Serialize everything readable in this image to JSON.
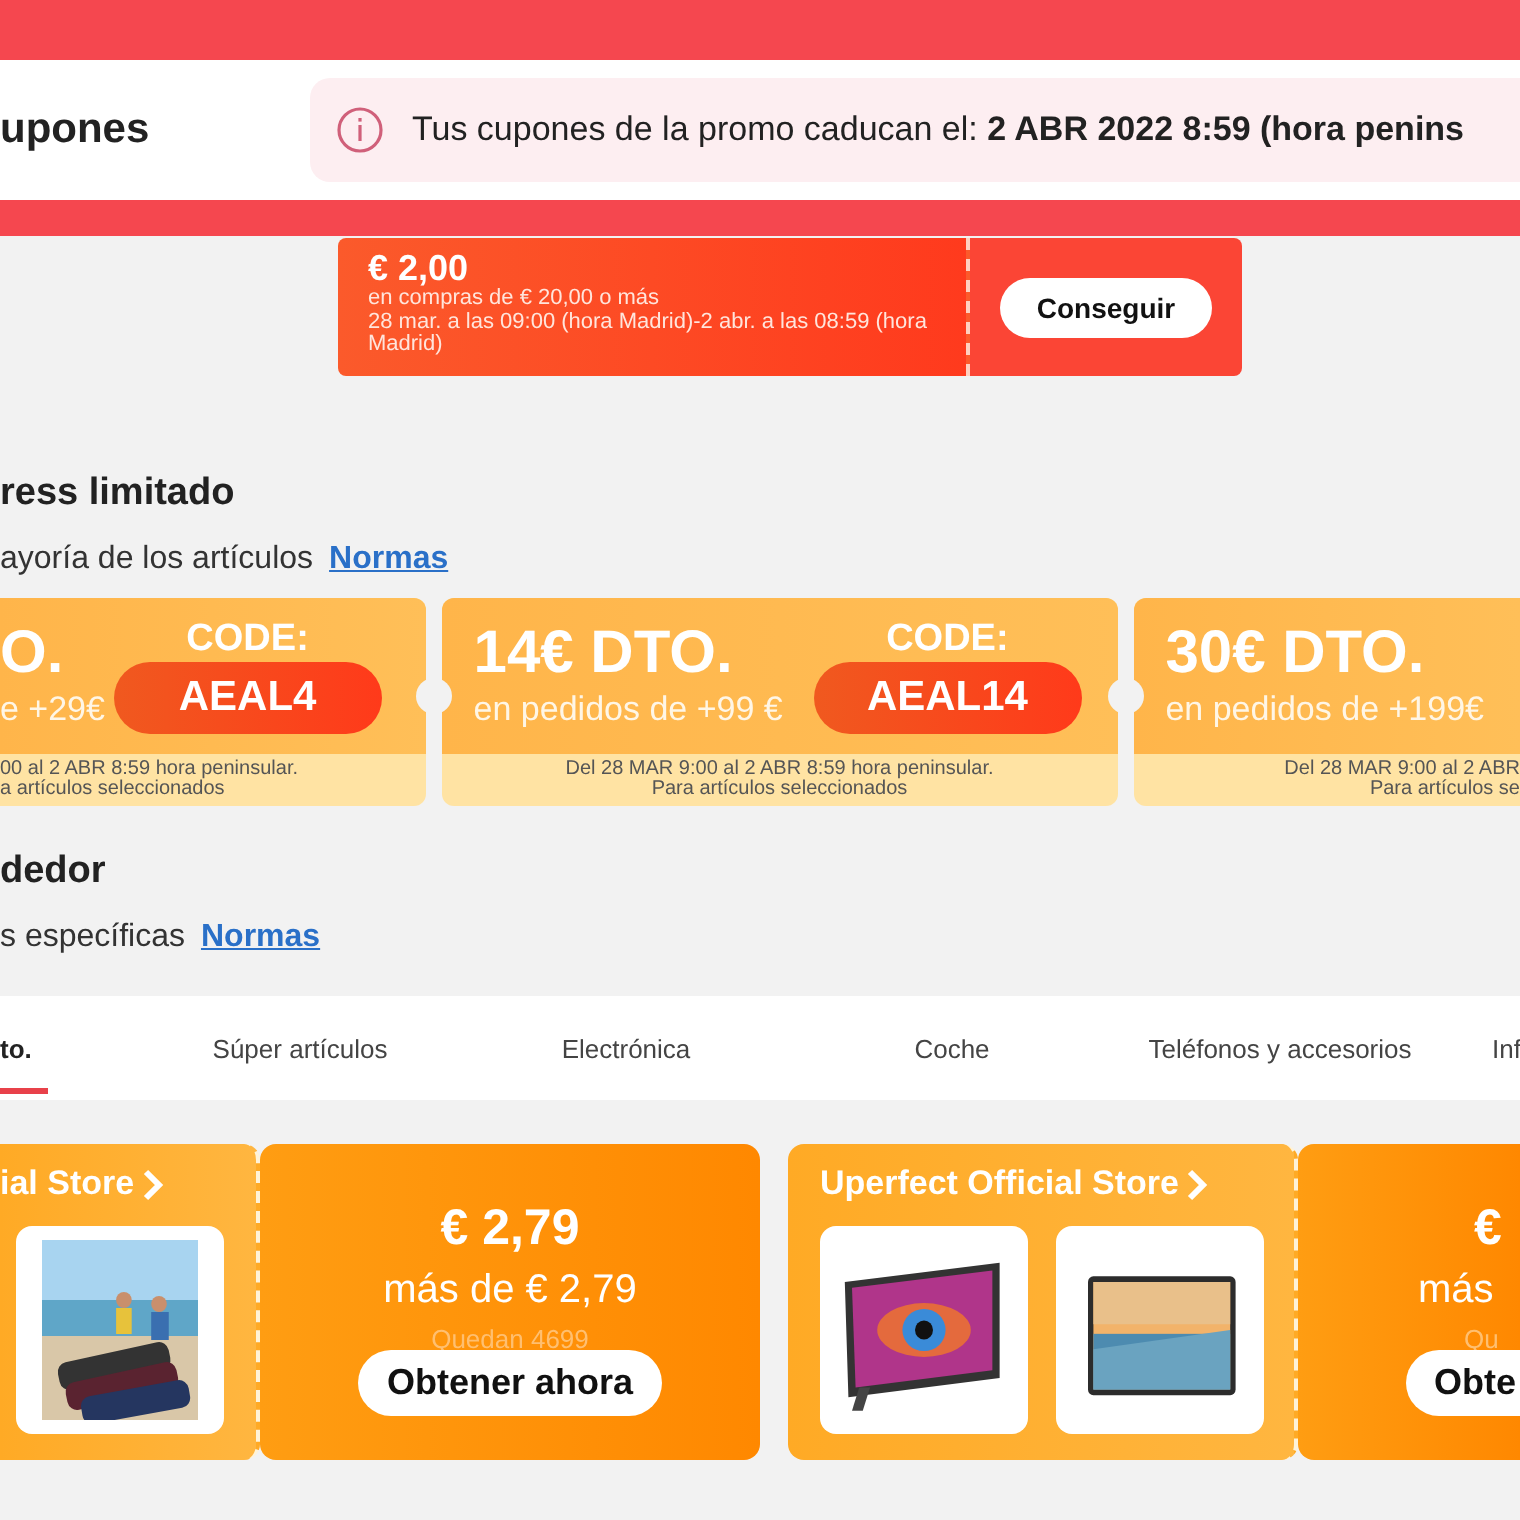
{
  "header": {
    "title": "upones",
    "notice": "Tus cupones de la promo caducan el: **2 ABR 2022 8:59 (hora penins**"
  },
  "coupon": {
    "amount": "€ 2,00",
    "condition": "en compras de € 20,00 o más",
    "validity": "28 mar. a las 09:00 (hora Madrid)-2 abr. a las 08:59 (hora Madrid)",
    "button": "Conseguir"
  },
  "express_section": {
    "title": "ress limitado",
    "subtitle": "ayoría de los artículos",
    "link": "Normas"
  },
  "code_coupons": [
    {
      "discount": "O.",
      "condition": "e +29€",
      "code_label": "CODE:",
      "code": "AEAL4",
      "terms": [
        "00 al 2 ABR 8:59 hora peninsular.",
        "a artículos seleccionados"
      ]
    },
    {
      "discount": "14€ DTO.",
      "condition": "en pedidos de +99 €",
      "code_label": "CODE:",
      "code": "AEAL14",
      "terms": [
        "Del 28 MAR 9:00 al 2 ABR 8:59 hora peninsular.",
        "Para artículos seleccionados"
      ]
    },
    {
      "discount": "30€ DTO.",
      "condition": "en pedidos de +199€",
      "terms": [
        "Del 28 MAR 9:00 al 2 ABR",
        "Para artículos se"
      ]
    }
  ],
  "seller_section": {
    "title": "dedor",
    "subtitle": "s específicas",
    "link": "Normas"
  },
  "tabs": [
    {
      "label": "to.",
      "selected": true
    },
    {
      "label": "Súper artículos",
      "selected": false
    },
    {
      "label": "Electrónica",
      "selected": false
    },
    {
      "label": "Coche",
      "selected": false
    },
    {
      "label": "Teléfonos y accesorios",
      "selected": false
    },
    {
      "label": "Inf",
      "selected": false
    }
  ],
  "store_coupons": [
    {
      "store": "ial Store",
      "price": "€ 2,79",
      "minimum": "más de € 2,79",
      "remaining": "Quedan 4699",
      "button": "Obtener ahora"
    },
    {
      "store": "Uperfect Official Store",
      "price": "€",
      "minimum": "más",
      "remaining": "Qu",
      "button": "Obte"
    }
  ]
}
